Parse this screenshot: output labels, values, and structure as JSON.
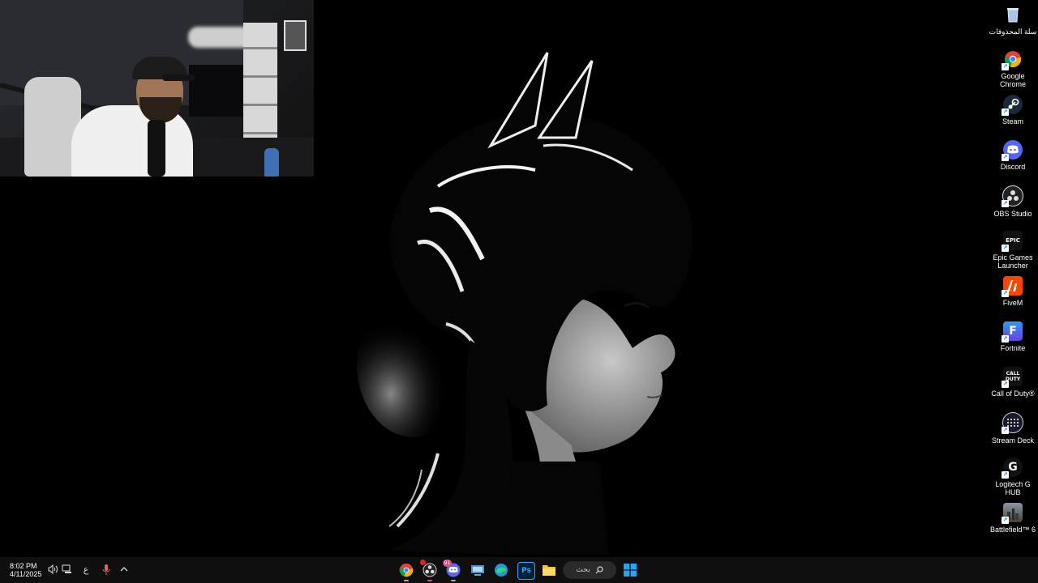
{
  "desktop": {
    "icons": [
      {
        "label": "سلة المحذوفات",
        "icon": "recycle-bin-icon"
      },
      {
        "label": "Google Chrome",
        "icon": "chrome-icon"
      },
      {
        "label": "Steam",
        "icon": "steam-icon"
      },
      {
        "label": "Discord",
        "icon": "discord-icon"
      },
      {
        "label": "OBS Studio",
        "icon": "obs-icon"
      },
      {
        "label": "Epic Games Launcher",
        "icon": "epic-games-icon",
        "glyph": "EPIC"
      },
      {
        "label": "FiveM",
        "icon": "fivem-icon"
      },
      {
        "label": "Fortnite",
        "icon": "fortnite-icon",
        "glyph": "F"
      },
      {
        "label": "Call of Duty®",
        "icon": "call-of-duty-icon",
        "glyph": "CALL DUTY"
      },
      {
        "label": "Stream Deck",
        "icon": "stream-deck-icon"
      },
      {
        "label": "Logitech G HUB",
        "icon": "logitech-g-hub-icon",
        "glyph": "G"
      },
      {
        "label": "Battlefield™ 6",
        "icon": "battlefield-icon"
      }
    ]
  },
  "taskbar": {
    "time": "8:02 PM",
    "date": "4/11/2025",
    "language": "ع",
    "search_label": "بحث",
    "discord_badge": "91",
    "apps": [
      "chrome-icon",
      "obs-icon",
      "discord-icon",
      "task-view-icon",
      "edge-icon",
      "photoshop-icon",
      "file-explorer-icon"
    ],
    "photoshop_glyph": "Ps"
  },
  "colors": {
    "taskbar_bg": "#0f0f0f",
    "accent": "#0078d4"
  }
}
